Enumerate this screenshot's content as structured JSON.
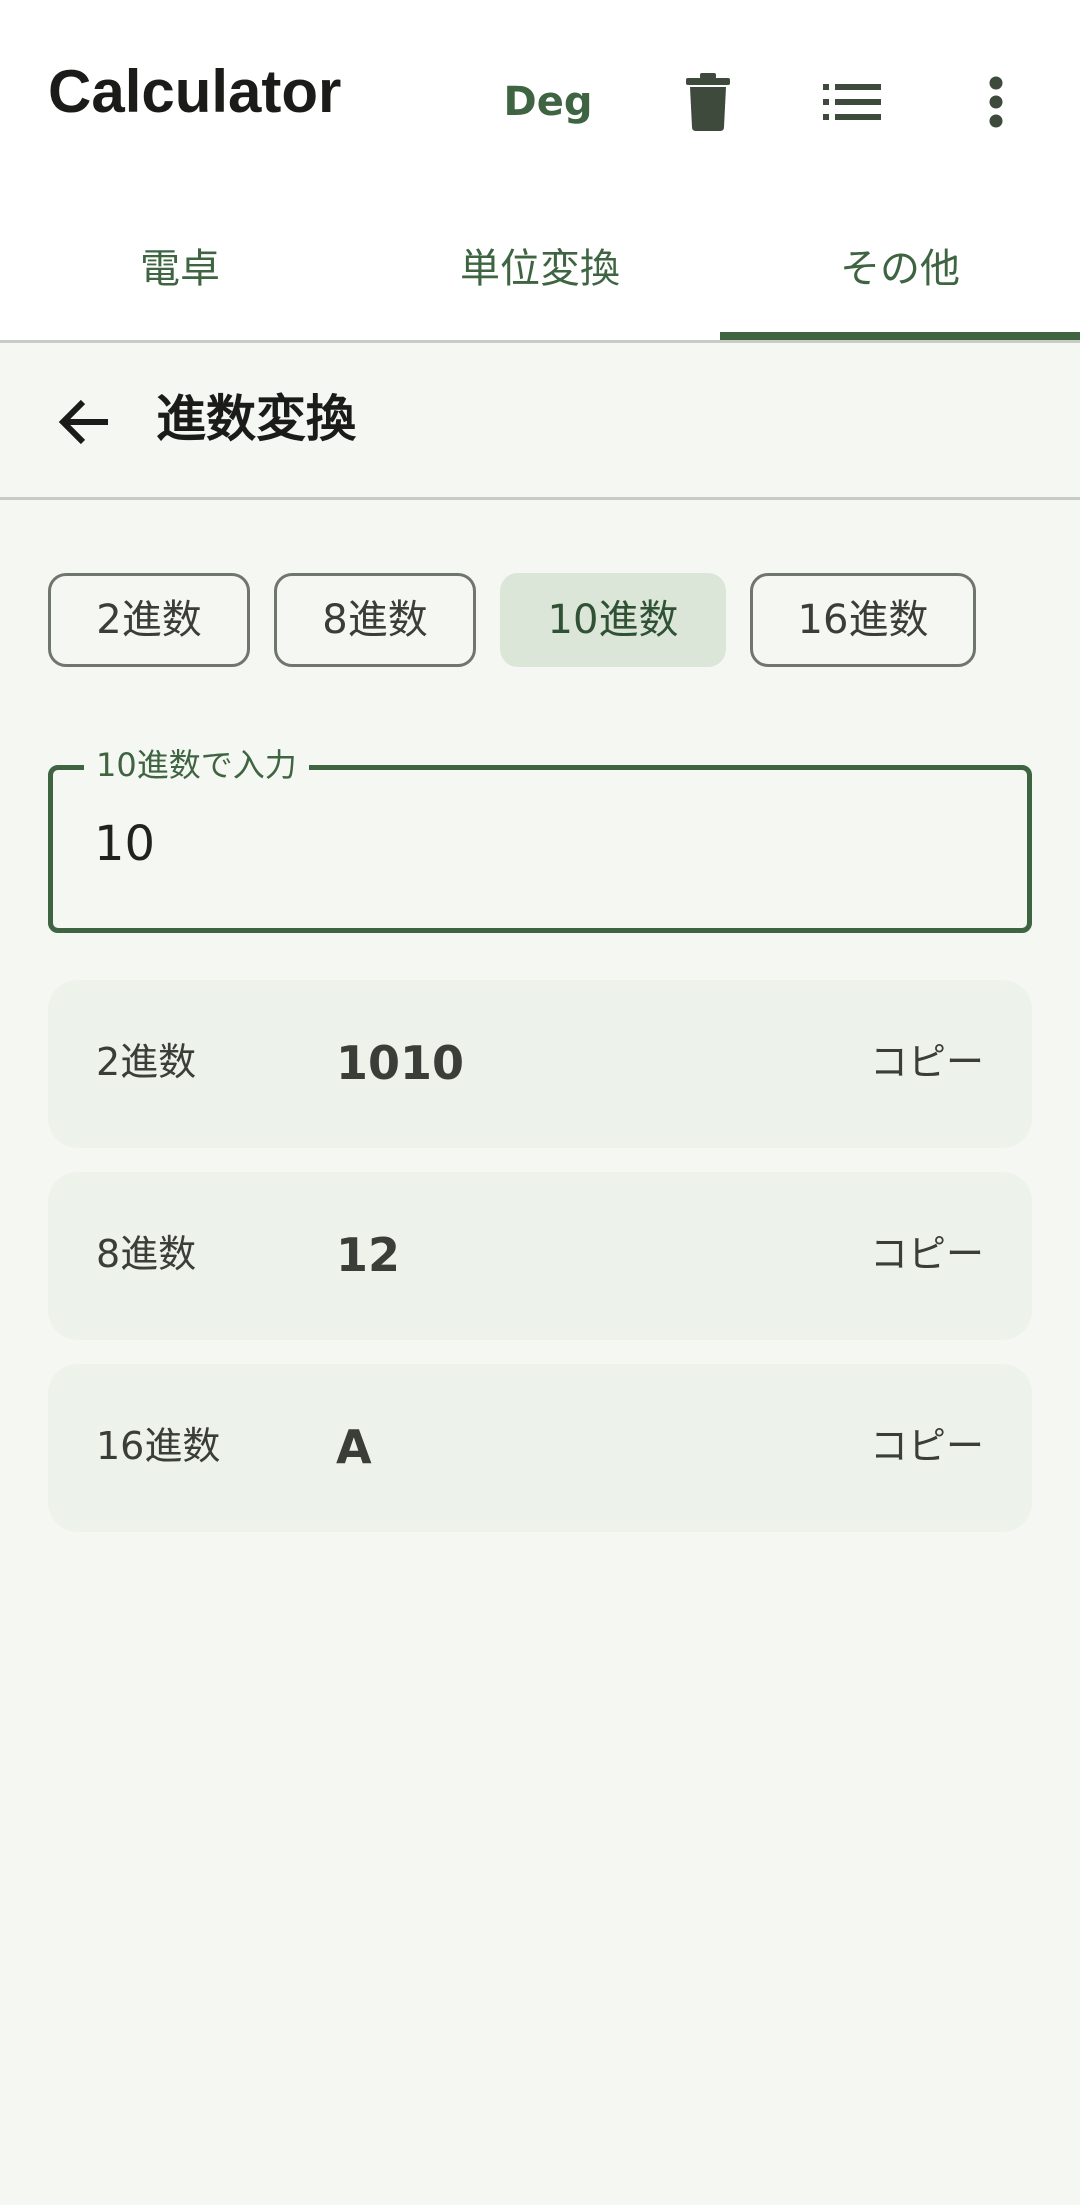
{
  "app_bar": {
    "title": "Calculator",
    "angle_mode": "Deg",
    "icons": [
      "trash-icon",
      "list-icon",
      "more-vert-icon"
    ]
  },
  "tabs": [
    {
      "label": "電卓",
      "selected": false
    },
    {
      "label": "単位変換",
      "selected": false
    },
    {
      "label": "その他",
      "selected": true
    }
  ],
  "page": {
    "title": "進数変換"
  },
  "base_chips": [
    {
      "label": "2進数",
      "selected": false
    },
    {
      "label": "8進数",
      "selected": false
    },
    {
      "label": "10進数",
      "selected": true
    },
    {
      "label": "16進数",
      "selected": false
    }
  ],
  "input": {
    "label": "10進数で入力",
    "value": "10"
  },
  "results": [
    {
      "label": "2進数",
      "value": "1010",
      "copy_label": "コピー"
    },
    {
      "label": "8進数",
      "value": "12",
      "copy_label": "コピー"
    },
    {
      "label": "16進数",
      "value": "A",
      "copy_label": "コピー"
    }
  ],
  "colors": {
    "accent": "#3e6442",
    "background": "#f5f7f2",
    "card": "#edf2ea",
    "chip_selected": "#dce6d8"
  }
}
